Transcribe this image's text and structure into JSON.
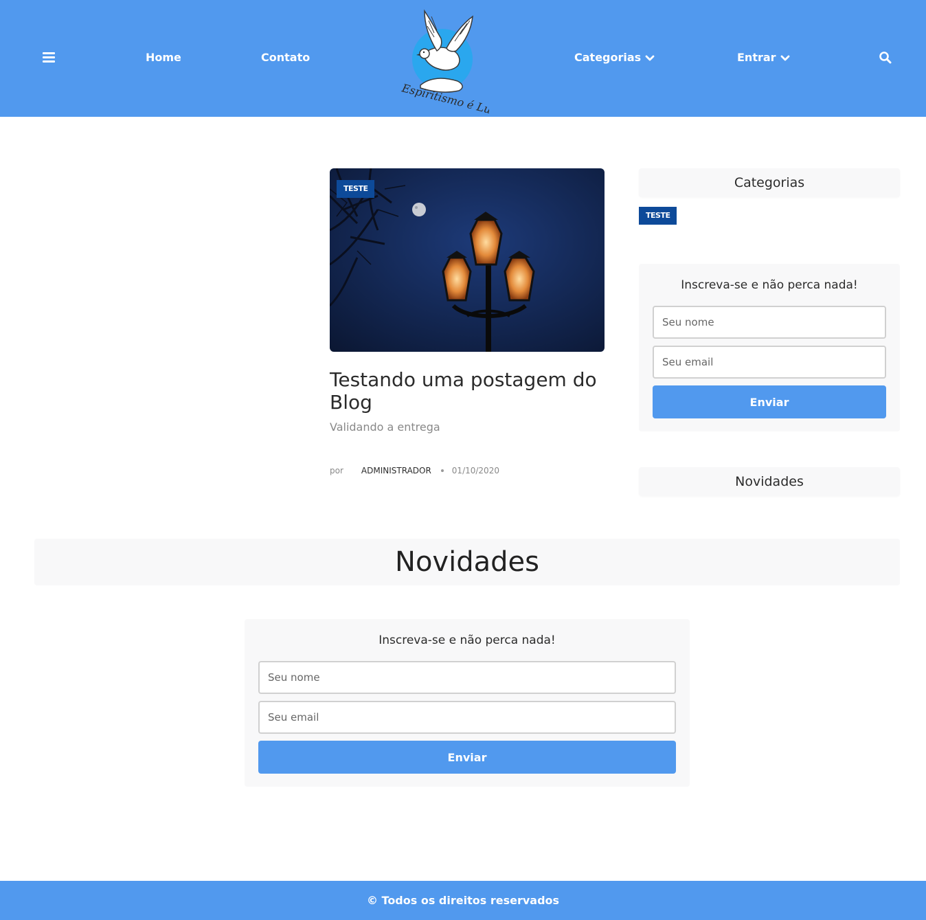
{
  "header": {
    "menu_icon": "hamburger-icon",
    "nav": {
      "home": "Home",
      "contato": "Contato",
      "categorias": "Categorias",
      "entrar": "Entrar"
    },
    "search_icon": "search-icon",
    "logo_text": "Espiritismo é Luz",
    "colors": {
      "bar": "#5199ee",
      "text": "#ffffff"
    }
  },
  "post": {
    "category": "TESTE",
    "title": "Testando uma postagem do Blog",
    "subtitle": "Validando a entrega",
    "by_label": "por",
    "author": "ADMINISTRADOR",
    "date": "01/10/2020"
  },
  "sidebar": {
    "categories_title": "Categorias",
    "category_badge": "TESTE",
    "subscribe": {
      "title": "Inscreva-se e não perca nada!",
      "name_placeholder": "Seu nome",
      "email_placeholder": "Seu email",
      "submit_label": "Enviar"
    },
    "novidades_title": "Novidades"
  },
  "novidades": {
    "title": "Novidades",
    "subscribe": {
      "title": "Inscreva-se e não perca nada!",
      "name_placeholder": "Seu nome",
      "email_placeholder": "Seu email",
      "submit_label": "Enviar"
    }
  },
  "footer": {
    "text": "© Todos os direitos reservados"
  },
  "colors": {
    "accent": "#5199ee",
    "badge": "#0d4a99",
    "panel": "#f8f8f9"
  }
}
